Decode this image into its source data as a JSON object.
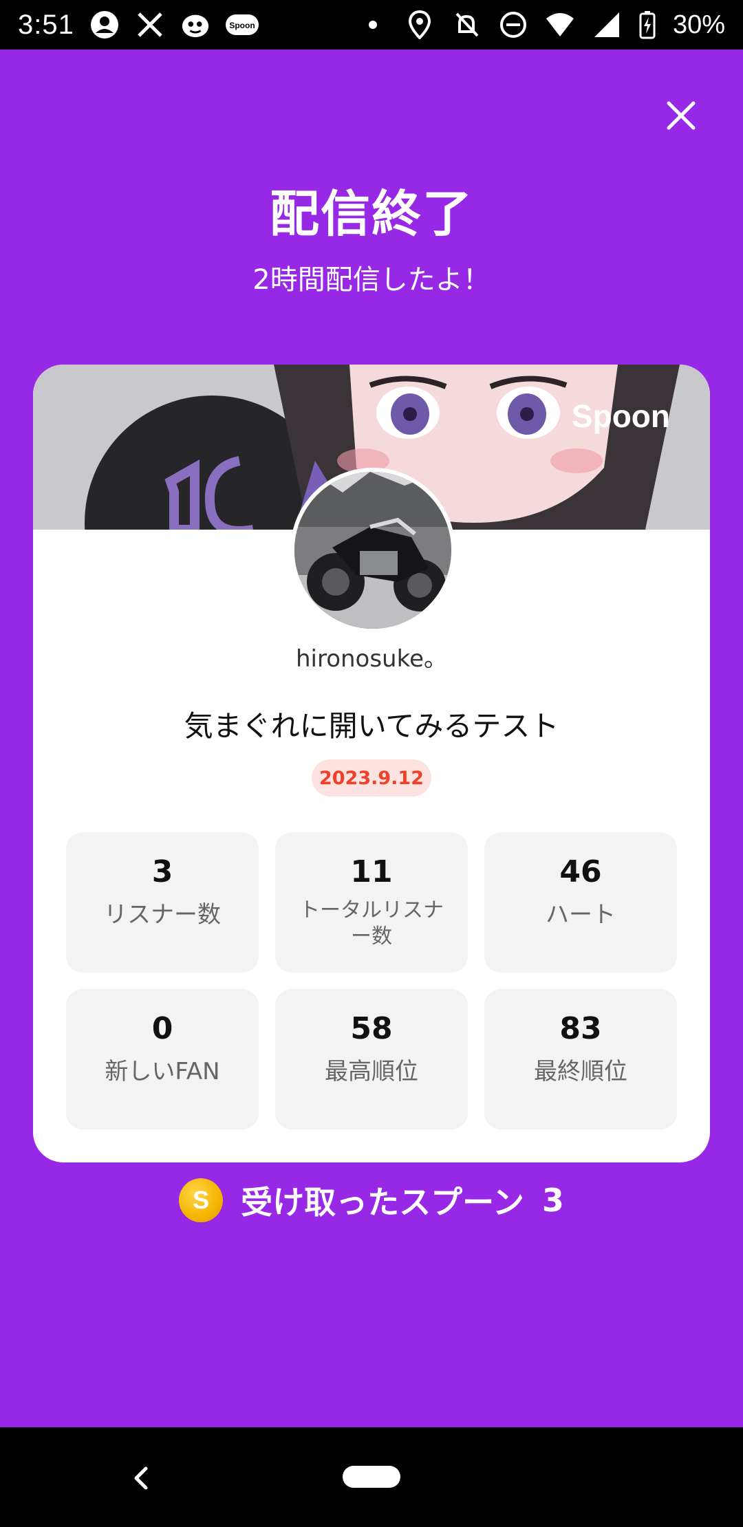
{
  "status_bar": {
    "time": "3:51",
    "battery": "30%",
    "icons": [
      "account-circle-icon",
      "x-logo-icon",
      "bear-app-icon",
      "spoon-app-icon",
      "dot-icon",
      "location-icon",
      "bell-off-icon",
      "do-not-disturb-icon",
      "wifi-icon",
      "signal-icon",
      "battery-charging-icon"
    ],
    "spoon_icon_text": "Spoon"
  },
  "header": {
    "title": "配信終了",
    "subtitle": "2時間配信したよ！"
  },
  "card": {
    "logo": "Spoon",
    "username": "hironosuke。",
    "stream_title": "気まぐれに開いてみるテスト",
    "date": "2023.9.12",
    "stats": [
      {
        "value": "3",
        "label": "リスナー数"
      },
      {
        "value": "11",
        "label": "トータルリスナー数"
      },
      {
        "value": "46",
        "label": "ハート"
      },
      {
        "value": "0",
        "label": "新しいFAN"
      },
      {
        "value": "58",
        "label": "最高順位"
      },
      {
        "value": "83",
        "label": "最終順位"
      }
    ]
  },
  "received": {
    "coin_symbol": "S",
    "label": "受け取ったスプーン",
    "count": "3"
  },
  "colors": {
    "background": "#9628e6",
    "date_badge_bg": "#fde3df",
    "date_badge_text": "#f0402a"
  }
}
